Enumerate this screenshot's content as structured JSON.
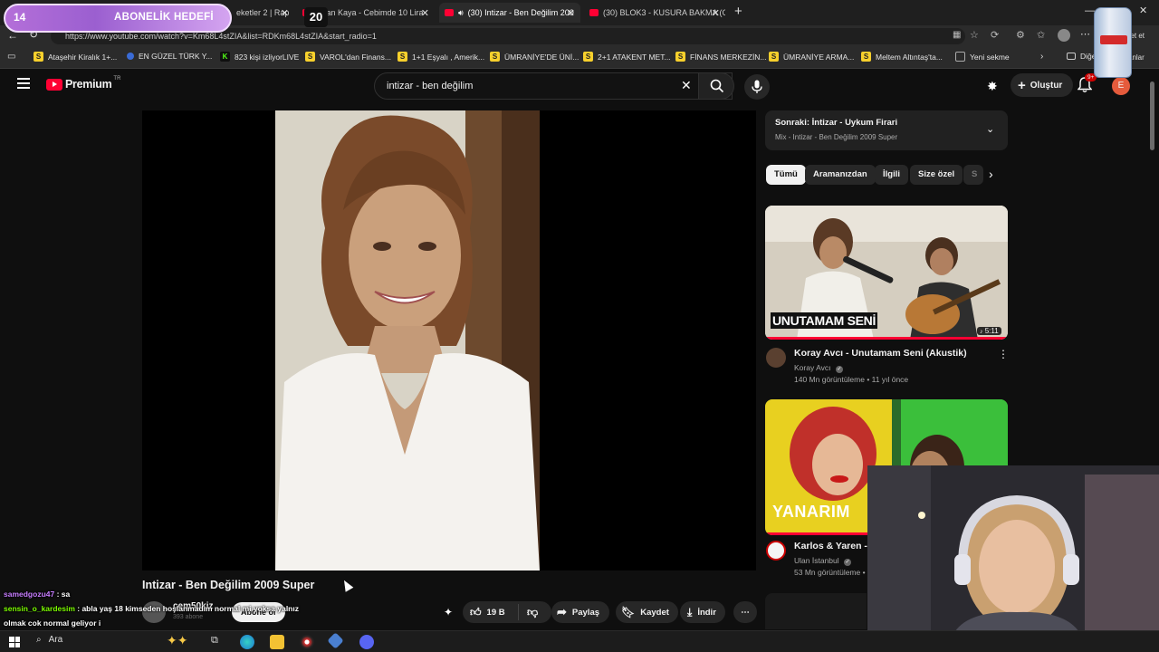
{
  "overlay": {
    "subscriber_goal_current": "14",
    "subscriber_goal_label": "ABONELİK HEDEFİ",
    "subscriber_goal_target": "20"
  },
  "browser": {
    "tabs": [
      {
        "label": "eketler 2 | Rap"
      },
      {
        "label": "aylan Kaya - Cebimde 10 Lira"
      },
      {
        "label": "(30) Intizar - Ben Değilim 200",
        "active": true
      },
      {
        "label": "(30) BLOK3 - KUSURA BAKMA (Of"
      }
    ],
    "new_tab_label": "+",
    "url": "https://www.youtube.com/watch?v=Km68L4stZIA&list=RDKm68L4stZIA&start_radio=1",
    "right_labels": [
      "bet et",
      "Diğer",
      "ılanlar"
    ],
    "bookmarks": [
      {
        "label": "Ataşehir Kiralık 1+...",
        "fav": "S",
        "color": "#f7d02c"
      },
      {
        "label": "EN GÜZEL TÜRK Y...",
        "fav": "",
        "color": "#3a6bd6"
      },
      {
        "label": "823 kişi izliyorLIVE",
        "fav": "K",
        "color": "#53fc18"
      },
      {
        "label": "VAROL'dan Finans...",
        "fav": "S",
        "color": "#f7d02c"
      },
      {
        "label": "1+1 Eşyalı , Amerik...",
        "fav": "S",
        "color": "#f7d02c"
      },
      {
        "label": "ÜMRANİYE'DE ÜNİ...",
        "fav": "S",
        "color": "#f7d02c"
      },
      {
        "label": "2+1 ATAKENT MET...",
        "fav": "S",
        "color": "#f7d02c"
      },
      {
        "label": "FİNANS MERKEZİN...",
        "fav": "S",
        "color": "#f7d02c"
      },
      {
        "label": "ÜMRANİYE ARMA...",
        "fav": "S",
        "color": "#f7d02c"
      },
      {
        "label": "Meltem Altıntaş'ta...",
        "fav": "S",
        "color": "#f7d02c"
      },
      {
        "label": "Yeni sekme",
        "fav": "",
        "color": "#888888"
      }
    ]
  },
  "youtube": {
    "logo_text": "Premium",
    "logo_badge": "TR",
    "search_value": "intizar - ben değilim",
    "create_label": "Oluştur",
    "notif_count": "9+",
    "avatar_letter": "E",
    "up_next": {
      "title": "Sonraki: İntizar - Uykum Firari",
      "subtitle": "Mix - Intizar - Ben Değilim 2009 Super"
    },
    "chips": [
      "Tümü",
      "Aramanızdan",
      "İlgili",
      "Size özel",
      "S"
    ],
    "related": [
      {
        "thumb_text": "UNUTAMAM SENİ",
        "duration": "5:11",
        "title": "Koray Avcı - Unutamam Seni (Akustik)",
        "channel": "Koray Avcı",
        "meta": "140 Mn görüntüleme • 11 yıl önce"
      },
      {
        "thumb_text": "YANARIM",
        "title": "Karlos & Yaren -",
        "channel": "Ulan İstanbul",
        "meta": "53 Mn görüntüleme • 3"
      }
    ],
    "video_title": "Intizar - Ben Değilim 2009 Super",
    "channel_name": "cem50kiz",
    "channel_subs": "393 abone",
    "subscribe_label": "Abone ol",
    "likes": "19 B",
    "share_label": "Paylaş",
    "save_label": "Kaydet",
    "download_label": "İndir"
  },
  "chat": [
    {
      "user": "samedgozu47",
      "message": " : sa",
      "color": "#c77dff"
    },
    {
      "user": "sensin_o_kardesim",
      "message": " : abla yaş 18 kimseden hoşlanmadım normal mi yoksa yalnız",
      "color": "#7cfc00"
    },
    {
      "user": "",
      "message": "olmak cok normal geliyor i",
      "color": "#ffffff"
    }
  ],
  "taskbar": {
    "search_label": "Ara"
  }
}
